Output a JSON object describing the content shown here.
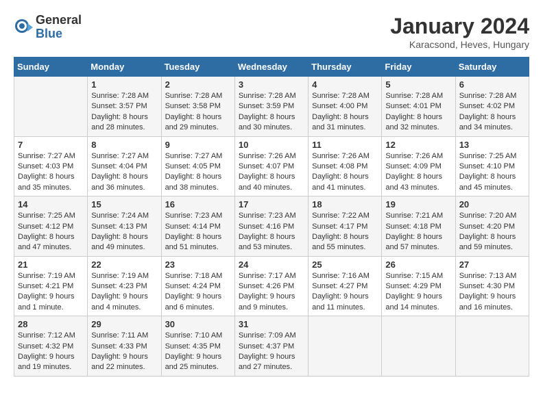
{
  "header": {
    "logo_general": "General",
    "logo_blue": "Blue",
    "month_title": "January 2024",
    "location": "Karacsond, Heves, Hungary"
  },
  "days_of_week": [
    "Sunday",
    "Monday",
    "Tuesday",
    "Wednesday",
    "Thursday",
    "Friday",
    "Saturday"
  ],
  "weeks": [
    [
      {
        "day": "",
        "info": ""
      },
      {
        "day": "1",
        "info": "Sunrise: 7:28 AM\nSunset: 3:57 PM\nDaylight: 8 hours\nand 28 minutes."
      },
      {
        "day": "2",
        "info": "Sunrise: 7:28 AM\nSunset: 3:58 PM\nDaylight: 8 hours\nand 29 minutes."
      },
      {
        "day": "3",
        "info": "Sunrise: 7:28 AM\nSunset: 3:59 PM\nDaylight: 8 hours\nand 30 minutes."
      },
      {
        "day": "4",
        "info": "Sunrise: 7:28 AM\nSunset: 4:00 PM\nDaylight: 8 hours\nand 31 minutes."
      },
      {
        "day": "5",
        "info": "Sunrise: 7:28 AM\nSunset: 4:01 PM\nDaylight: 8 hours\nand 32 minutes."
      },
      {
        "day": "6",
        "info": "Sunrise: 7:28 AM\nSunset: 4:02 PM\nDaylight: 8 hours\nand 34 minutes."
      }
    ],
    [
      {
        "day": "7",
        "info": "Sunrise: 7:27 AM\nSunset: 4:03 PM\nDaylight: 8 hours\nand 35 minutes."
      },
      {
        "day": "8",
        "info": "Sunrise: 7:27 AM\nSunset: 4:04 PM\nDaylight: 8 hours\nand 36 minutes."
      },
      {
        "day": "9",
        "info": "Sunrise: 7:27 AM\nSunset: 4:05 PM\nDaylight: 8 hours\nand 38 minutes."
      },
      {
        "day": "10",
        "info": "Sunrise: 7:26 AM\nSunset: 4:07 PM\nDaylight: 8 hours\nand 40 minutes."
      },
      {
        "day": "11",
        "info": "Sunrise: 7:26 AM\nSunset: 4:08 PM\nDaylight: 8 hours\nand 41 minutes."
      },
      {
        "day": "12",
        "info": "Sunrise: 7:26 AM\nSunset: 4:09 PM\nDaylight: 8 hours\nand 43 minutes."
      },
      {
        "day": "13",
        "info": "Sunrise: 7:25 AM\nSunset: 4:10 PM\nDaylight: 8 hours\nand 45 minutes."
      }
    ],
    [
      {
        "day": "14",
        "info": "Sunrise: 7:25 AM\nSunset: 4:12 PM\nDaylight: 8 hours\nand 47 minutes."
      },
      {
        "day": "15",
        "info": "Sunrise: 7:24 AM\nSunset: 4:13 PM\nDaylight: 8 hours\nand 49 minutes."
      },
      {
        "day": "16",
        "info": "Sunrise: 7:23 AM\nSunset: 4:14 PM\nDaylight: 8 hours\nand 51 minutes."
      },
      {
        "day": "17",
        "info": "Sunrise: 7:23 AM\nSunset: 4:16 PM\nDaylight: 8 hours\nand 53 minutes."
      },
      {
        "day": "18",
        "info": "Sunrise: 7:22 AM\nSunset: 4:17 PM\nDaylight: 8 hours\nand 55 minutes."
      },
      {
        "day": "19",
        "info": "Sunrise: 7:21 AM\nSunset: 4:18 PM\nDaylight: 8 hours\nand 57 minutes."
      },
      {
        "day": "20",
        "info": "Sunrise: 7:20 AM\nSunset: 4:20 PM\nDaylight: 8 hours\nand 59 minutes."
      }
    ],
    [
      {
        "day": "21",
        "info": "Sunrise: 7:19 AM\nSunset: 4:21 PM\nDaylight: 9 hours\nand 1 minute."
      },
      {
        "day": "22",
        "info": "Sunrise: 7:19 AM\nSunset: 4:23 PM\nDaylight: 9 hours\nand 4 minutes."
      },
      {
        "day": "23",
        "info": "Sunrise: 7:18 AM\nSunset: 4:24 PM\nDaylight: 9 hours\nand 6 minutes."
      },
      {
        "day": "24",
        "info": "Sunrise: 7:17 AM\nSunset: 4:26 PM\nDaylight: 9 hours\nand 9 minutes."
      },
      {
        "day": "25",
        "info": "Sunrise: 7:16 AM\nSunset: 4:27 PM\nDaylight: 9 hours\nand 11 minutes."
      },
      {
        "day": "26",
        "info": "Sunrise: 7:15 AM\nSunset: 4:29 PM\nDaylight: 9 hours\nand 14 minutes."
      },
      {
        "day": "27",
        "info": "Sunrise: 7:13 AM\nSunset: 4:30 PM\nDaylight: 9 hours\nand 16 minutes."
      }
    ],
    [
      {
        "day": "28",
        "info": "Sunrise: 7:12 AM\nSunset: 4:32 PM\nDaylight: 9 hours\nand 19 minutes."
      },
      {
        "day": "29",
        "info": "Sunrise: 7:11 AM\nSunset: 4:33 PM\nDaylight: 9 hours\nand 22 minutes."
      },
      {
        "day": "30",
        "info": "Sunrise: 7:10 AM\nSunset: 4:35 PM\nDaylight: 9 hours\nand 25 minutes."
      },
      {
        "day": "31",
        "info": "Sunrise: 7:09 AM\nSunset: 4:37 PM\nDaylight: 9 hours\nand 27 minutes."
      },
      {
        "day": "",
        "info": ""
      },
      {
        "day": "",
        "info": ""
      },
      {
        "day": "",
        "info": ""
      }
    ]
  ]
}
